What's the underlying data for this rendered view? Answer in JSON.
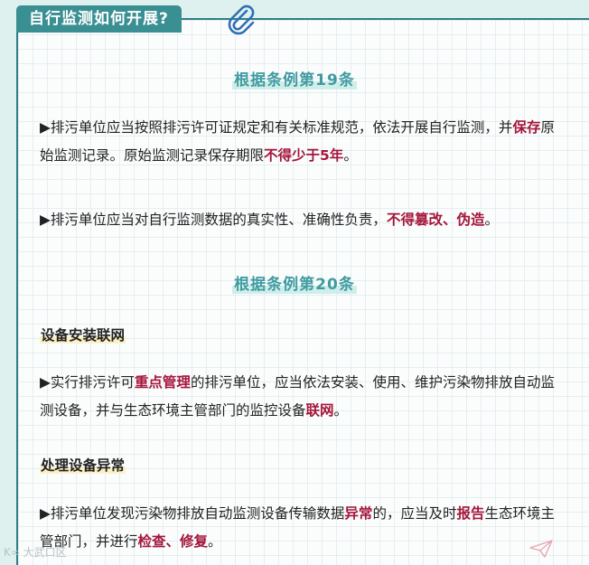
{
  "header": {
    "title": "自行监测如何开展?"
  },
  "icons": {
    "clip": "paperclip-icon",
    "plane": "paper-plane-icon"
  },
  "colors": {
    "accent": "#3a8f92",
    "heading": "#3f9ba1",
    "emphasis": "#a4163b"
  },
  "sections": [
    {
      "heading": "根据条例第19条",
      "paragraphs": [
        {
          "parts": [
            {
              "text": "▶排污单位应当按照排污许可证规定和有关标准规范，依法开展自行监测，并",
              "em": false
            },
            {
              "text": "保存",
              "em": true
            },
            {
              "text": "原始监测记录。原始监测记录保存期限",
              "em": false
            },
            {
              "text": "不得少于5年",
              "em": true
            },
            {
              "text": "。",
              "em": false
            }
          ]
        },
        {
          "parts": [
            {
              "text": "▶排污单位应当对自行监测数据的真实性、准确性负责，",
              "em": false
            },
            {
              "text": "不得篡改、伪造",
              "em": true
            },
            {
              "text": "。",
              "em": false
            }
          ]
        }
      ]
    },
    {
      "heading": "根据条例第20条",
      "subsections": [
        {
          "title": "设备安装联网",
          "parts": [
            {
              "text": "▶实行排污许可",
              "em": false
            },
            {
              "text": "重点管理",
              "em": true
            },
            {
              "text": "的排污单位，应当依法安装、使用、维护污染物排放自动监测设备，并与生态环境主管部门的监控设备",
              "em": false
            },
            {
              "text": "联网",
              "em": true
            },
            {
              "text": "。",
              "em": false
            }
          ]
        },
        {
          "title": "处理设备异常",
          "parts": [
            {
              "text": "▶排污单位发现污染物排放自动监测设备传输数据",
              "em": false
            },
            {
              "text": "异常",
              "em": true
            },
            {
              "text": "的，应当及时",
              "em": false
            },
            {
              "text": "报告",
              "em": true
            },
            {
              "text": "生态环境主管部门，并进行",
              "em": false
            },
            {
              "text": "检查、修复",
              "em": true
            },
            {
              "text": "。",
              "em": false
            }
          ]
        }
      ]
    }
  ],
  "watermark": "K∞ 大武口区"
}
